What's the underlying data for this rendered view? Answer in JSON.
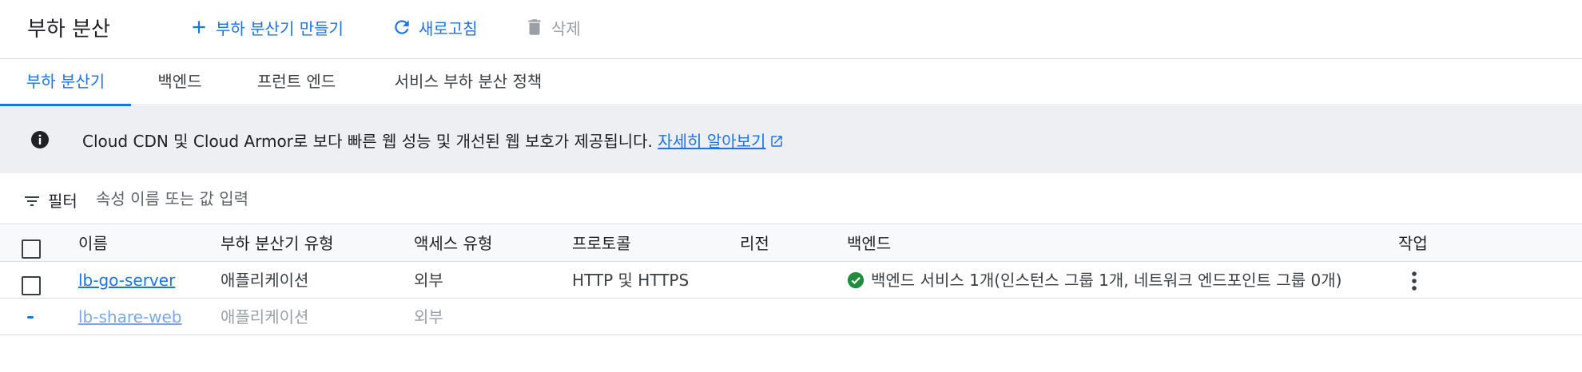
{
  "header": {
    "title": "부하 분산",
    "create_label": "부하 분산기 만들기",
    "refresh_label": "새로고침",
    "delete_label": "삭제"
  },
  "tabs": [
    {
      "label": "부하 분산기",
      "active": true
    },
    {
      "label": "백엔드",
      "active": false
    },
    {
      "label": "프런트 엔드",
      "active": false
    },
    {
      "label": "서비스 부하 분산 정책",
      "active": false
    }
  ],
  "banner": {
    "text": "Cloud CDN 및 Cloud Armor로 보다 빠른 웹 성능 및 개선된 웹 보호가 제공됩니다.",
    "link": "자세히 알아보기"
  },
  "filter": {
    "label": "필터",
    "placeholder": "속성 이름 또는 값 입력"
  },
  "table": {
    "headers": {
      "name": "이름",
      "type": "부하 분산기 유형",
      "access": "액세스 유형",
      "protocol": "프로토콜",
      "region": "리전",
      "backend": "백엔드",
      "action": "작업"
    },
    "rows": [
      {
        "name": "lb-go-server",
        "type": "애플리케이션",
        "access": "외부",
        "protocol": "HTTP 및 HTTPS",
        "region": "",
        "backend": "백엔드 서비스 1개(인스턴스 그룹 1개, 네트워크 엔드포인트 그룹 0개)"
      },
      {
        "name": "lb-share-web",
        "type": "애플리케이션",
        "access": "외부",
        "protocol": "",
        "region": "",
        "backend": ""
      }
    ]
  },
  "colors": {
    "accent": "#1a73e8",
    "success": "#1e8e3e",
    "banner_bg": "#edeff2",
    "border": "#dadce0"
  },
  "icons": [
    "plus-icon",
    "refresh-icon",
    "trash-icon",
    "info-icon",
    "external-link-icon",
    "filter-icon",
    "check-circle-icon",
    "more-vert-icon"
  ]
}
